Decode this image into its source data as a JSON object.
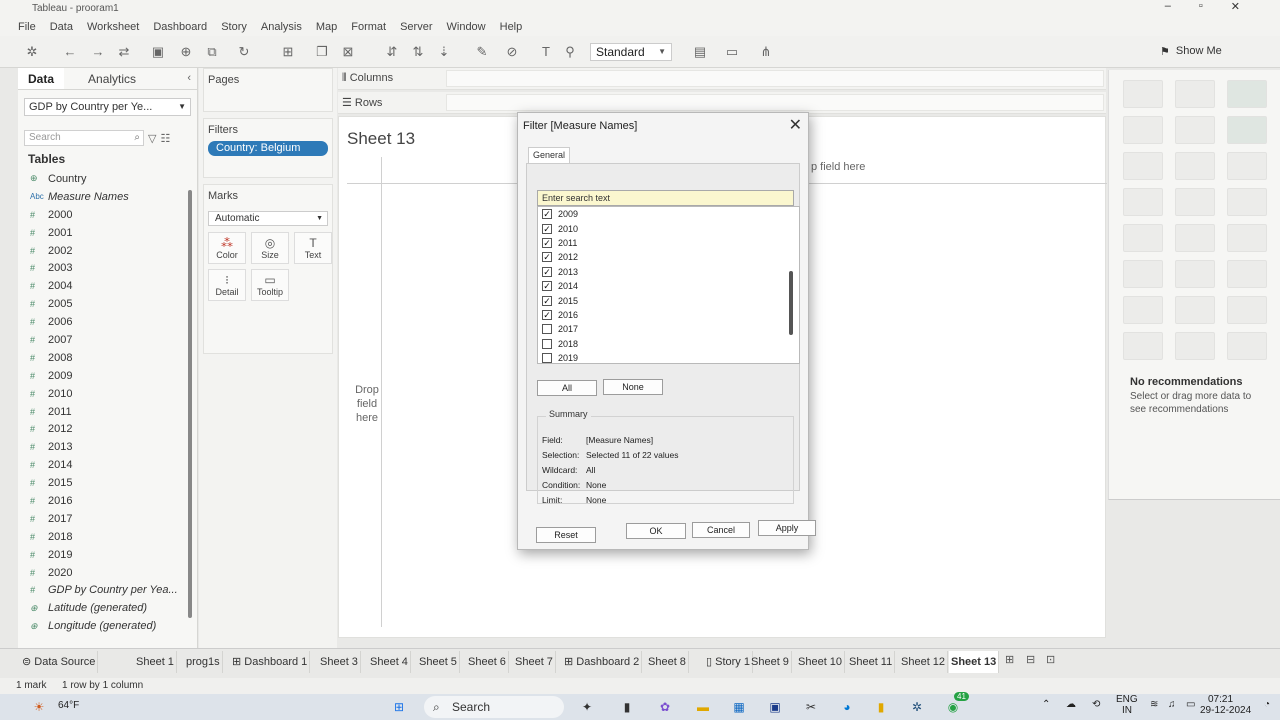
{
  "window": {
    "title": "Tableau - prooram1"
  },
  "menu": [
    "File",
    "Data",
    "Worksheet",
    "Dashboard",
    "Story",
    "Analysis",
    "Map",
    "Format",
    "Server",
    "Window",
    "Help"
  ],
  "toolbar": {
    "view_size": "Standard",
    "show_me": "Show Me"
  },
  "left_pane": {
    "tab_data": "Data",
    "tab_analytics": "Analytics",
    "datasource": "GDP by Country per Ye...",
    "search_placeholder": "Search",
    "tables_heading": "Tables",
    "fields": [
      {
        "name": "Country",
        "icon": "globe-icon",
        "italic": false
      },
      {
        "name": "Measure Names",
        "icon": "abc-icon",
        "italic": true
      },
      {
        "name": "2000",
        "icon": "measure-icon",
        "italic": false
      },
      {
        "name": "2001",
        "icon": "measure-icon",
        "italic": false
      },
      {
        "name": "2002",
        "icon": "measure-icon",
        "italic": false
      },
      {
        "name": "2003",
        "icon": "measure-icon",
        "italic": false
      },
      {
        "name": "2004",
        "icon": "measure-icon",
        "italic": false
      },
      {
        "name": "2005",
        "icon": "measure-icon",
        "italic": false
      },
      {
        "name": "2006",
        "icon": "measure-icon",
        "italic": false
      },
      {
        "name": "2007",
        "icon": "measure-icon",
        "italic": false
      },
      {
        "name": "2008",
        "icon": "measure-icon",
        "italic": false
      },
      {
        "name": "2009",
        "icon": "measure-icon",
        "italic": false
      },
      {
        "name": "2010",
        "icon": "measure-icon",
        "italic": false
      },
      {
        "name": "2011",
        "icon": "measure-icon",
        "italic": false
      },
      {
        "name": "2012",
        "icon": "measure-icon",
        "italic": false
      },
      {
        "name": "2013",
        "icon": "measure-icon",
        "italic": false
      },
      {
        "name": "2014",
        "icon": "measure-icon",
        "italic": false
      },
      {
        "name": "2015",
        "icon": "measure-icon",
        "italic": false
      },
      {
        "name": "2016",
        "icon": "measure-icon",
        "italic": false
      },
      {
        "name": "2017",
        "icon": "measure-icon",
        "italic": false
      },
      {
        "name": "2018",
        "icon": "measure-icon",
        "italic": false
      },
      {
        "name": "2019",
        "icon": "measure-icon",
        "italic": false
      },
      {
        "name": "2020",
        "icon": "measure-icon",
        "italic": false
      },
      {
        "name": "GDP by Country per Yea...",
        "icon": "measure-icon",
        "italic": true
      },
      {
        "name": "Latitude (generated)",
        "icon": "globe-icon",
        "italic": true
      },
      {
        "name": "Longitude (generated)",
        "icon": "globe-icon",
        "italic": true
      }
    ]
  },
  "cards": {
    "pages": "Pages",
    "filters": "Filters",
    "filter_pill": "Country: Belgium",
    "marks": "Marks",
    "mark_type": "Automatic",
    "mark_buttons": [
      {
        "label": "Color",
        "icon": "color-icon"
      },
      {
        "label": "Size",
        "icon": "size-icon"
      },
      {
        "label": "Text",
        "icon": "text-icon"
      },
      {
        "label": "Detail",
        "icon": "detail-icon"
      },
      {
        "label": "Tooltip",
        "icon": "tooltip-icon"
      }
    ]
  },
  "shelves": {
    "columns": "Columns",
    "rows": "Rows"
  },
  "canvas": {
    "sheet_title": "Sheet 13",
    "drop_rows": "Drop field here",
    "drop_cols": "p field here"
  },
  "show_me_panel": {
    "no_rec_title": "No recommendations",
    "no_rec_text": "Select or drag more data to see recommendations"
  },
  "dialog": {
    "title": "Filter [Measure Names]",
    "tab": "General",
    "search_placeholder": "Enter search text",
    "items": [
      {
        "label": "2009",
        "checked": true
      },
      {
        "label": "2010",
        "checked": true
      },
      {
        "label": "2011",
        "checked": true
      },
      {
        "label": "2012",
        "checked": true
      },
      {
        "label": "2013",
        "checked": true
      },
      {
        "label": "2014",
        "checked": true
      },
      {
        "label": "2015",
        "checked": true
      },
      {
        "label": "2016",
        "checked": true
      },
      {
        "label": "2017",
        "checked": false
      },
      {
        "label": "2018",
        "checked": false
      },
      {
        "label": "2019",
        "checked": false
      }
    ],
    "all_button": "All",
    "none_button": "None",
    "summary_heading": "Summary",
    "summary": [
      {
        "key": "Field:",
        "value": "[Measure Names]"
      },
      {
        "key": "Selection:",
        "value": "Selected 11 of 22 values"
      },
      {
        "key": "Wildcard:",
        "value": "All"
      },
      {
        "key": "Condition:",
        "value": "None"
      },
      {
        "key": "Limit:",
        "value": "None"
      }
    ],
    "reset_button": "Reset",
    "ok_button": "OK",
    "cancel_button": "Cancel",
    "apply_button": "Apply"
  },
  "sheet_tabs": {
    "data_source": "Data Source",
    "tabs": [
      "Sheet 1",
      "prog1s",
      "Dashboard 1",
      "Sheet 3",
      "Sheet 4",
      "Sheet 5",
      "Sheet 6",
      "Sheet 7",
      "Dashboard 2",
      "Sheet 8",
      "Story 1",
      "Sheet 9",
      "Sheet 10",
      "Sheet 11",
      "Sheet 12",
      "Sheet 13"
    ],
    "active": "Sheet 13"
  },
  "status": {
    "marks": "1 mark",
    "rowcol": "1 row by 1 column"
  },
  "taskbar": {
    "weather": "64°F",
    "search": "Search",
    "lang": "ENG",
    "region": "IN",
    "time": "07:21",
    "date": "29-12-2024",
    "badge": "41"
  }
}
